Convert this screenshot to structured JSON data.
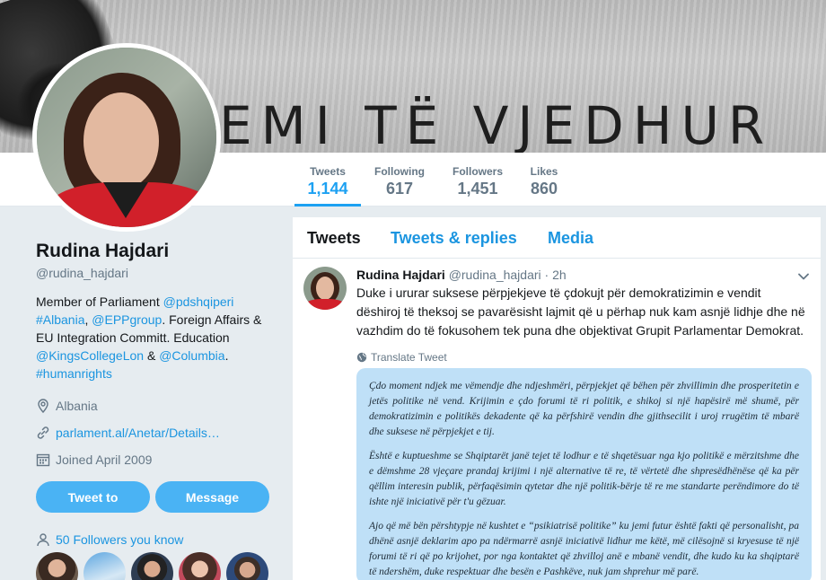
{
  "banner": {
    "text": "EMI TË VJEDHUR"
  },
  "nav": {
    "items": [
      {
        "label": "Tweets",
        "value": "1,144",
        "active": true
      },
      {
        "label": "Following",
        "value": "617"
      },
      {
        "label": "Followers",
        "value": "1,451"
      },
      {
        "label": "Likes",
        "value": "860"
      }
    ]
  },
  "profile": {
    "name": "Rudina Hajdari",
    "handle": "@rudina_hajdari",
    "bio": {
      "t1": "Member of Parliament ",
      "l1": "@pdshqiperi",
      "l2": "#Albania",
      "t2": ", ",
      "l3": "@EPPgroup",
      "t3": ". Foreign Affairs & EU Integration Committ. Education ",
      "l4": "@KingsCollegeLon",
      "t4": " & ",
      "l5": "@Columbia",
      "t5": ". ",
      "l6": "#humanrights"
    },
    "location": "Albania",
    "website": "parlament.al/Anetar/Details…",
    "joined": "Joined April 2009",
    "tweet_to_label": "Tweet to",
    "message_label": "Message",
    "followers_you_know": "50 Followers you know"
  },
  "timeline": {
    "tabs": [
      "Tweets",
      "Tweets & replies",
      "Media"
    ]
  },
  "tweet": {
    "name": "Rudina Hajdari",
    "handle": "@rudina_hajdari",
    "dot": "·",
    "time": "2h",
    "text": "Duke i ururar suksese  përpjekjeve të çdokujt për demokratizimin e vendit dëshiroj të theksoj se pavarësisht lajmit që u përhap nuk kam asnjë lidhje dhe në vazhdim do të fokusohem tek puna dhe objektivat Grupit Parlamentar Demokrat.",
    "translate": "Translate Tweet",
    "image_paragraphs": [
      "Çdo moment ndjek me vëmendje dhe ndjeshmëri, përpjekjet që bëhen për zhvillimin dhe prosperitetin e jetës politike në vend. Krijimin e çdo forumi të ri politik, e shikoj si një hapësirë më shumë, për demokratizimin e politikës dekadente që ka përfshirë vendin dhe gjithsecilit i uroj rrugëtim të mbarë dhe suksese në përpjekjet e tij.",
      "Është e kuptueshme se Shqiptarët janë tejet të lodhur e të shqetësuar nga kjo politikë e mërzitshme dhe e dëmshme 28 vjeçare prandaj krijimi i një alternative të re, të vërtetë dhe shpresëdhënëse që ka për qëllim interesin publik, përfaqësimin qytetar dhe një politik-bërje të re me standarte perëndimore do të ishte një iniciativë për t'u gëzuar.",
      "Ajo që më bën përshtypje në kushtet e “psikiatrisë politike” ku jemi futur është fakti që personalisht, pa dhënë asnjë deklarim apo pa ndërmarrë asnjë iniciativë lidhur me këtë, më cilësojnë si kryesuse të një forumi të ri që po krijohet, por nga kontaktet që zhvilloj anë e mbanë vendit, dhe kudo ku ka shqiptarë të ndershëm, duke respektuar dhe besën e Pashkëve, nuk jam shprehur më parë."
    ]
  },
  "colors": {
    "accent": "#1da1f2",
    "link": "#1b95e0",
    "button": "#4ab3f4",
    "card": "#bfe0f7"
  }
}
